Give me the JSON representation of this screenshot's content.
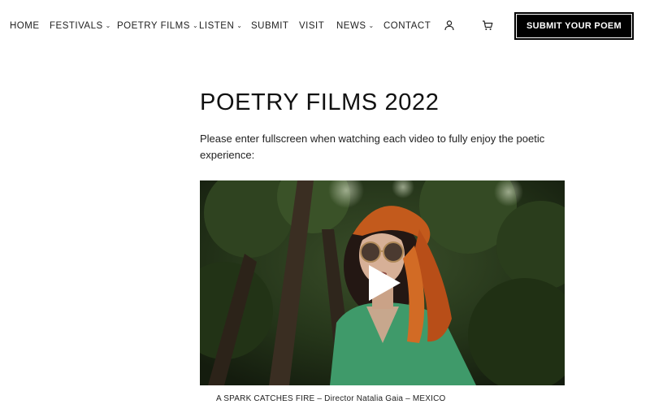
{
  "nav": {
    "items": [
      {
        "label": "HOME",
        "dropdown": false
      },
      {
        "label": "FESTIVALS",
        "dropdown": true
      },
      {
        "label": "POETRY FILMS",
        "dropdown": true
      },
      {
        "label": "LISTEN",
        "dropdown": true
      },
      {
        "label": "SUBMIT",
        "dropdown": false
      },
      {
        "label": "VISIT",
        "dropdown": false
      },
      {
        "label": "NEWS",
        "dropdown": true
      },
      {
        "label": "CONTACT",
        "dropdown": false
      }
    ],
    "icons": [
      "user-icon",
      "cart-icon"
    ],
    "cta_label": "SUBMIT YOUR POEM"
  },
  "main": {
    "title": "POETRY FILMS 2022",
    "intro": "Please enter fullscreen when watching each video to fully enjoy the poetic experience:",
    "video": {
      "caption": "A SPARK CATCHES FIRE – Director Natalia Gaia – MEXICO",
      "play_icon": "play-icon"
    }
  },
  "colors": {
    "text": "#1a1a1a",
    "cta_background": "#000000",
    "cta_text": "#ffffff"
  }
}
